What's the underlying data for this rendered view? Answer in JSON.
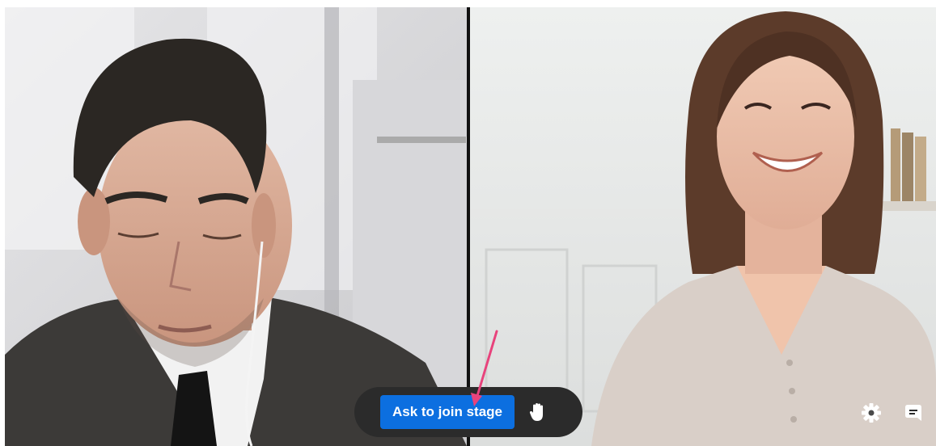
{
  "controls": {
    "join_label": "Ask to join stage",
    "raise_hand_icon": "raise-hand-icon",
    "settings_icon": "gear-icon",
    "chat_icon": "chat-icon"
  },
  "colors": {
    "join_button": "#0c6fe0",
    "control_bar": "#2b2b2b",
    "annotation_arrow": "#e8437c"
  }
}
